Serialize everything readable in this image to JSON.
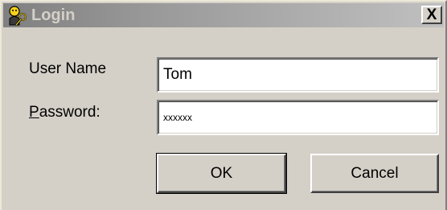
{
  "window": {
    "title": "Login",
    "app_icon": "keys-person-icon",
    "close_label": "X"
  },
  "form": {
    "username_label": "User Name",
    "username_value": "Tom",
    "password_label_accel": "P",
    "password_label_rest": "assword:",
    "password_value": "xxxxxx"
  },
  "buttons": {
    "ok_label": "OK",
    "cancel_label": "Cancel"
  },
  "colors": {
    "window_face": "#d4d0c8",
    "titlebar_start": "#808080",
    "titlebar_end": "#c0c0c0",
    "field_background": "#ffffff"
  }
}
